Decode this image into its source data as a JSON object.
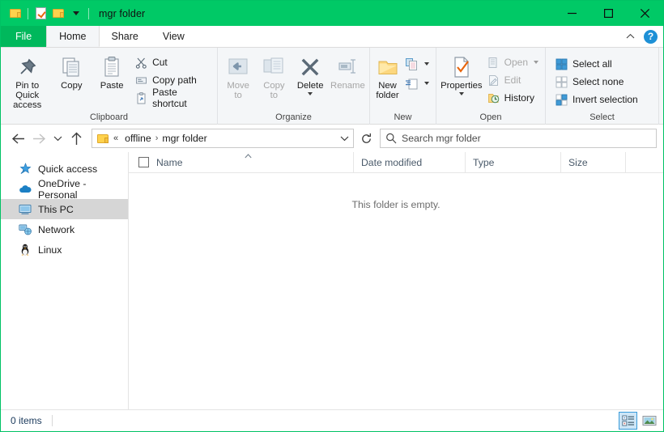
{
  "window": {
    "title": "mgr folder",
    "accent_green": "#00c966",
    "file_tab_green": "#00b85c",
    "quick_access_toolbar": [
      {
        "name": "folder-icon",
        "tooltip": "Folder"
      },
      {
        "name": "properties-icon",
        "tooltip": "Properties"
      },
      {
        "name": "new-folder-icon",
        "tooltip": "New folder"
      }
    ],
    "controls": {
      "minimize": "Minimize",
      "maximize": "Maximize",
      "close": "Close"
    }
  },
  "tabs": [
    {
      "label": "File",
      "active": false,
      "kind": "file"
    },
    {
      "label": "Home",
      "active": true,
      "kind": "normal"
    },
    {
      "label": "Share",
      "active": false,
      "kind": "normal"
    },
    {
      "label": "View",
      "active": false,
      "kind": "normal"
    }
  ],
  "tabrow_right": {
    "collapse_tooltip": "Minimize the Ribbon",
    "help_label": "?"
  },
  "ribbon": {
    "groups": [
      {
        "label": "Clipboard",
        "big_buttons": [
          {
            "label": "Pin to Quick\naccess",
            "icon": "pin-icon",
            "disabled": false
          },
          {
            "label": "Copy",
            "icon": "copy-icon",
            "disabled": false
          },
          {
            "label": "Paste",
            "icon": "paste-icon",
            "disabled": false
          }
        ],
        "small_buttons": [
          {
            "label": "Cut",
            "icon": "scissors-icon",
            "disabled": false
          },
          {
            "label": "Copy path",
            "icon": "copy-path-icon",
            "disabled": false
          },
          {
            "label": "Paste shortcut",
            "icon": "paste-shortcut-icon",
            "disabled": false
          }
        ]
      },
      {
        "label": "Organize",
        "big_buttons": [
          {
            "label": "Move\nto",
            "icon": "move-to-icon",
            "disabled": true,
            "has_caret": true
          },
          {
            "label": "Copy\nto",
            "icon": "copy-to-icon",
            "disabled": true,
            "has_caret": true
          },
          {
            "label": "Delete",
            "icon": "delete-x-icon",
            "disabled": false,
            "has_caret": true
          },
          {
            "label": "Rename",
            "icon": "rename-icon",
            "disabled": true
          }
        ]
      },
      {
        "label": "New",
        "big_buttons": [
          {
            "label": "New\nfolder",
            "icon": "new-folder-icon",
            "disabled": false
          }
        ],
        "split_buttons": [
          {
            "name": "new-item-button",
            "icon": "new-item-icon"
          },
          {
            "name": "easy-access-button",
            "icon": "easy-access-icon"
          }
        ]
      },
      {
        "label": "Open",
        "big_buttons": [
          {
            "label": "Properties",
            "icon": "properties-icon",
            "disabled": false,
            "has_caret": true
          }
        ],
        "small_buttons": [
          {
            "label": "Open",
            "icon": "open-icon",
            "disabled": true,
            "has_caret": true
          },
          {
            "label": "Edit",
            "icon": "edit-icon",
            "disabled": true
          },
          {
            "label": "History",
            "icon": "history-icon",
            "disabled": false
          }
        ]
      },
      {
        "label": "Select",
        "small_buttons": [
          {
            "label": "Select all",
            "icon": "select-all-icon",
            "disabled": false
          },
          {
            "label": "Select none",
            "icon": "select-none-icon",
            "disabled": false
          },
          {
            "label": "Invert selection",
            "icon": "invert-selection-icon",
            "disabled": false
          }
        ]
      }
    ]
  },
  "addressbar": {
    "back_tooltip": "Back",
    "forward_tooltip": "Forward",
    "recent_tooltip": "Recent locations",
    "up_tooltip": "Up",
    "breadcrumb_overflow": "«",
    "breadcrumbs": [
      "offline",
      "mgr folder"
    ],
    "separator": "›",
    "dropdown_tooltip": "Previous locations",
    "refresh_tooltip": "Refresh",
    "search_placeholder": "Search mgr folder",
    "search_value": ""
  },
  "sidebar": {
    "items": [
      {
        "label": "Quick access",
        "icon": "star-pin-icon",
        "selected": false
      },
      {
        "label": "OneDrive - Personal",
        "icon": "cloud-icon",
        "selected": false
      },
      {
        "label": "This PC",
        "icon": "monitor-icon",
        "selected": true
      },
      {
        "label": "Network",
        "icon": "network-icon",
        "selected": false
      },
      {
        "label": "Linux",
        "icon": "penguin-icon",
        "selected": false
      }
    ]
  },
  "filelist": {
    "columns": [
      {
        "label": "Name",
        "sorted": true,
        "sort_direction": "ascending"
      },
      {
        "label": "Date modified",
        "sorted": false
      },
      {
        "label": "Type",
        "sorted": false
      },
      {
        "label": "Size",
        "sorted": false
      }
    ],
    "rows": [],
    "empty_message": "This folder is empty."
  },
  "statusbar": {
    "item_count": "0 items",
    "view_buttons": [
      {
        "name": "details-view-button",
        "label": "Details view",
        "active": true
      },
      {
        "name": "large-icons-view-button",
        "label": "Large icons view",
        "active": false
      }
    ]
  }
}
